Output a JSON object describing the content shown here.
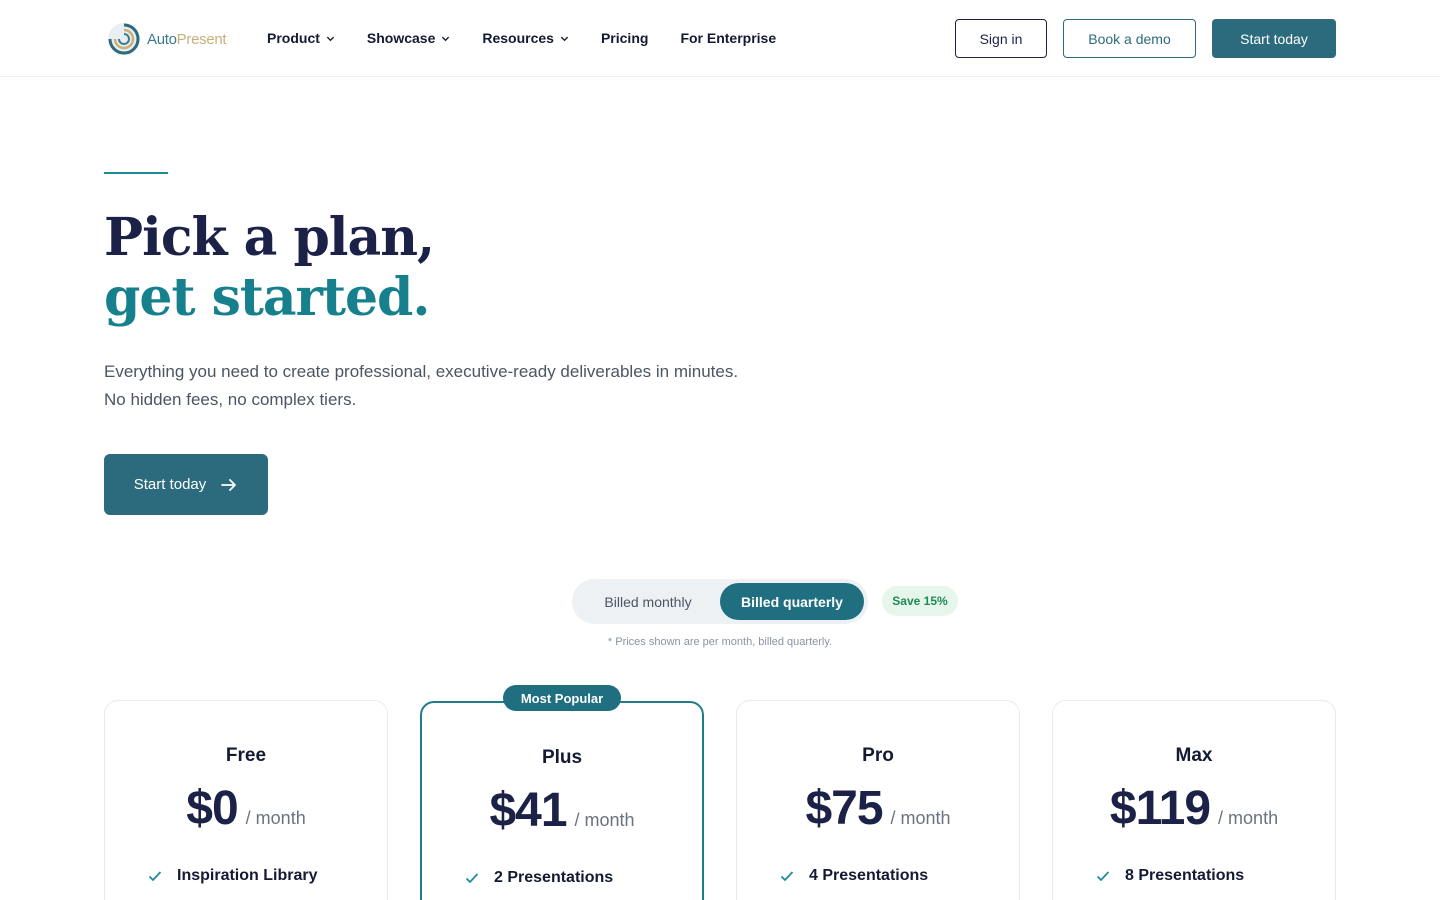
{
  "brand": {
    "name_part1": "Auto",
    "name_part2": "Present"
  },
  "nav": {
    "items": [
      {
        "label": "Product",
        "has_dropdown": true
      },
      {
        "label": "Showcase",
        "has_dropdown": true
      },
      {
        "label": "Resources",
        "has_dropdown": true
      },
      {
        "label": "Pricing",
        "has_dropdown": false
      },
      {
        "label": "For Enterprise",
        "has_dropdown": false
      }
    ],
    "sign_in": "Sign in",
    "book_demo": "Book a demo",
    "start_today": "Start today"
  },
  "hero": {
    "title_line1": "Pick a plan,",
    "title_line2": "get started.",
    "subtitle": "Everything you need to create professional, executive-ready deliverables in minutes. No hidden fees, no complex tiers.",
    "cta": "Start today"
  },
  "billing": {
    "monthly": "Billed monthly",
    "quarterly": "Billed quarterly",
    "selected": "quarterly",
    "save_badge": "Save 15%",
    "note": "* Prices shown are per month, billed quarterly."
  },
  "plans": [
    {
      "name": "Free",
      "price": "$0",
      "per": "/ month",
      "feature": "Inspiration Library",
      "popular": false
    },
    {
      "name": "Plus",
      "price": "$41",
      "per": "/ month",
      "feature": "2 Presentations",
      "popular": true,
      "badge": "Most Popular"
    },
    {
      "name": "Pro",
      "price": "$75",
      "per": "/ month",
      "feature": "4 Presentations",
      "popular": false
    },
    {
      "name": "Max",
      "price": "$119",
      "per": "/ month",
      "feature": "8 Presentations",
      "popular": false
    }
  ],
  "colors": {
    "primary": "#2b6b7d",
    "navy": "#1b2147",
    "teal": "#16808d",
    "save_green": "#1f8a52"
  }
}
